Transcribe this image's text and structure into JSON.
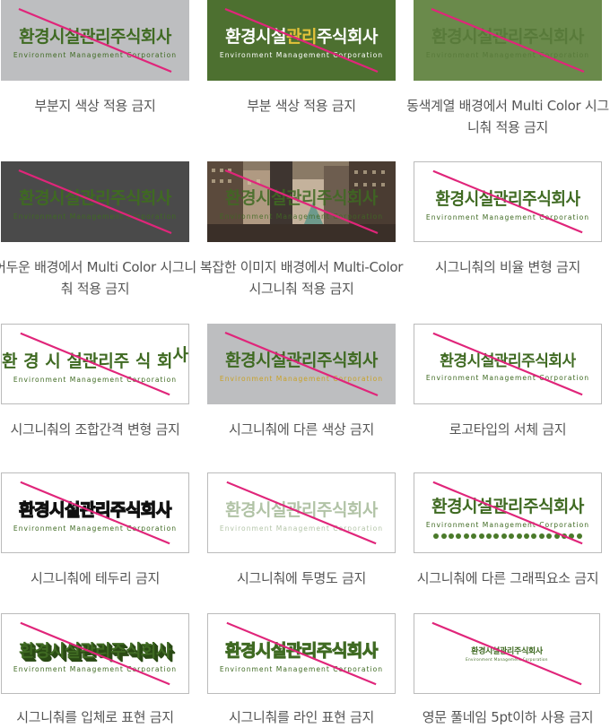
{
  "logo": {
    "korean": "환경시설관리주식회사",
    "english": "Environment Management Corporation",
    "korean_spaced": [
      "환",
      "경",
      "시",
      "설",
      "관",
      "리",
      "주",
      "식",
      "회",
      "사"
    ]
  },
  "colors": {
    "brand_green": "#3f6a22",
    "accent_gold": "#c9a227",
    "slash_pink": "#e0257a",
    "caption_gray": "#555555"
  },
  "items": [
    {
      "caption": "부분지 색상 적용 금지"
    },
    {
      "caption": "부분 색상 적용 금지"
    },
    {
      "caption": "동색계열 배경에서 Multi Color 시그니춰 적용 금지"
    },
    {
      "caption": "어두운 배경에서 Multi Color 시그니춰 적용 금지"
    },
    {
      "caption": "복잡한 이미지 배경에서 Multi-Color 시그니춰 적용 금지"
    },
    {
      "caption": "시그니춰의 비율 변형 금지"
    },
    {
      "caption": "시그니춰의 조합간격 변형 금지"
    },
    {
      "caption": "시그니춰에 다른 색상 금지"
    },
    {
      "caption": "로고타입의 서체 금지"
    },
    {
      "caption": "시그니춰에 테두리 금지"
    },
    {
      "caption": "시그니춰에 투명도 금지"
    },
    {
      "caption": "시그니춰에 다른 그래픽요소 금지"
    },
    {
      "caption": "시그니춰를 입체로 표현 금지"
    },
    {
      "caption": "시그니춰를 라인 표현 금지"
    },
    {
      "caption": "영문 풀네임 5pt이하 사용 금지"
    }
  ]
}
